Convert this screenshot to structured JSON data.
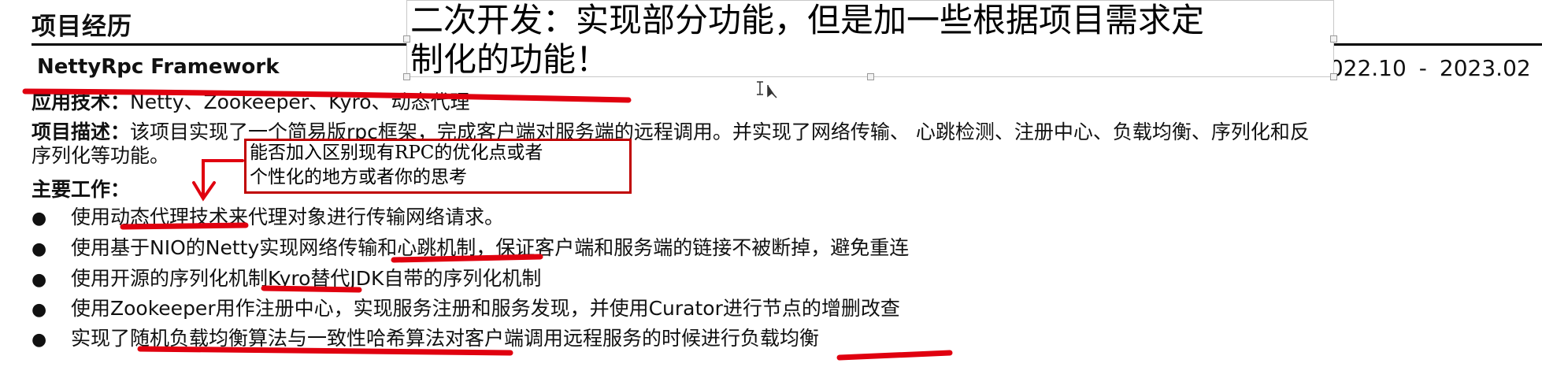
{
  "section_title": "项目经历",
  "project": {
    "name": "NettyRpc Framework",
    "date_start": "2022.10",
    "date_sep": "-",
    "date_end": "2023.02"
  },
  "tech_line": {
    "label": "应用技术：",
    "value": "Netty、Zookeeper、Kyro、动态代理"
  },
  "description": {
    "label": "项目描述：",
    "line1": "该项目实现了一个简易版rpc框架，完成客户端对服务端的远程调用。并实现了网络传输、 心跳检测、注册中心、负载均衡、序列化和反",
    "line2": "序列化等功能。"
  },
  "main_work_title": "主要工作：",
  "bullets": [
    "使用动态代理技术来代理对象进行传输网络请求。",
    "使用基于NIO的Netty实现网络传输和心跳机制，保证客户端和服务端的链接不被断掉，避免重连",
    "使用开源的序列化机制Kyro替代JDK自带的序列化机制",
    "使用Zookeeper用作注册中心，实现服务注册和服务发现，并使用Curator进行节点的增删改查",
    "实现了随机负载均衡算法与一致性哈希算法对客户端调用远程服务的时候进行负载均衡"
  ],
  "bullet_symbol": "●",
  "annotation_textbox": {
    "line1": "二次开发：实现部分功能，但是加一些根据项目需求定",
    "line2": "制化的功能！"
  },
  "annotation_comment": {
    "line1": "能否加入区别现有RPC的优化点或者",
    "line2": "个性化的地方或者你的思考"
  },
  "colors": {
    "annotation_red": "#e0000f",
    "comment_border": "#c00000",
    "text": "#111111"
  },
  "icons": {
    "cursor": "text-cursor-icon"
  }
}
